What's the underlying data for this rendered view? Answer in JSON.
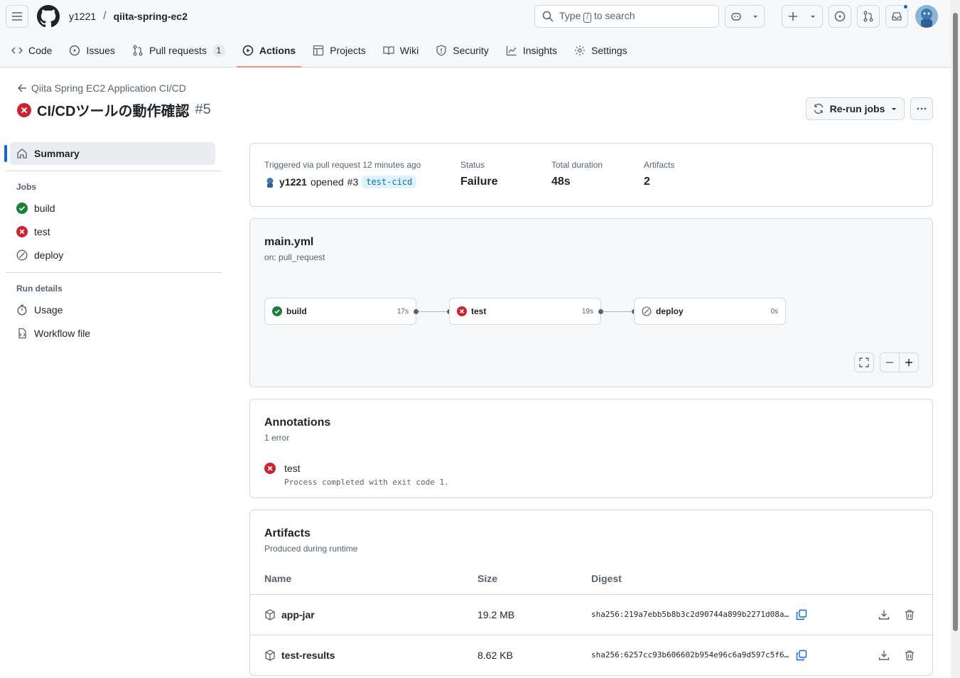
{
  "header": {
    "owner": "y1221",
    "separator": "/",
    "repo": "qiita-spring-ec2",
    "search": {
      "prefix": "Type",
      "key": "/",
      "suffix": "to search"
    }
  },
  "tabs": [
    {
      "label": "Code"
    },
    {
      "label": "Issues"
    },
    {
      "label": "Pull requests",
      "count": "1"
    },
    {
      "label": "Actions"
    },
    {
      "label": "Projects"
    },
    {
      "label": "Wiki"
    },
    {
      "label": "Security"
    },
    {
      "label": "Insights"
    },
    {
      "label": "Settings"
    }
  ],
  "run": {
    "workflow_name": "Qiita Spring EC2 Application CI/CD",
    "title": "CI/CDツールの動作確認",
    "number": "#5",
    "rerun_label": "Re-run jobs"
  },
  "sidebar": {
    "summary": "Summary",
    "jobs_heading": "Jobs",
    "jobs": [
      {
        "label": "build",
        "status": "success"
      },
      {
        "label": "test",
        "status": "failure"
      },
      {
        "label": "deploy",
        "status": "skipped"
      }
    ],
    "details_heading": "Run details",
    "details": [
      {
        "label": "Usage"
      },
      {
        "label": "Workflow file"
      }
    ]
  },
  "summary": {
    "trigger_label": "Triggered via pull request 12 minutes ago",
    "actor": "y1221",
    "action": "opened",
    "pr": "#3",
    "branch": "test-cicd",
    "status_label": "Status",
    "status_value": "Failure",
    "duration_label": "Total duration",
    "duration_value": "48s",
    "artifacts_label": "Artifacts",
    "artifacts_value": "2"
  },
  "workflow": {
    "file": "main.yml",
    "trigger": "on: pull_request",
    "jobs": [
      {
        "name": "build",
        "duration": "17s",
        "status": "success"
      },
      {
        "name": "test",
        "duration": "19s",
        "status": "failure"
      },
      {
        "name": "deploy",
        "duration": "0s",
        "status": "skipped"
      }
    ]
  },
  "annotations": {
    "title": "Annotations",
    "count": "1 error",
    "items": [
      {
        "job": "test",
        "message": "Process completed with exit code 1."
      }
    ]
  },
  "artifacts": {
    "title": "Artifacts",
    "subtitle": "Produced during runtime",
    "columns": {
      "name": "Name",
      "size": "Size",
      "digest": "Digest"
    },
    "rows": [
      {
        "name": "app-jar",
        "size": "19.2 MB",
        "digest": "sha256:219a7ebb5b8b3c2d90744a899b2271d08a…"
      },
      {
        "name": "test-results",
        "size": "8.62 KB",
        "digest": "sha256:6257cc93b606602b954e96c6a9d597c5f6…"
      }
    ]
  },
  "colors": {
    "success": "#1a7f37",
    "failure": "#cf222e",
    "accent": "#fd8c73",
    "link": "#0969da"
  }
}
